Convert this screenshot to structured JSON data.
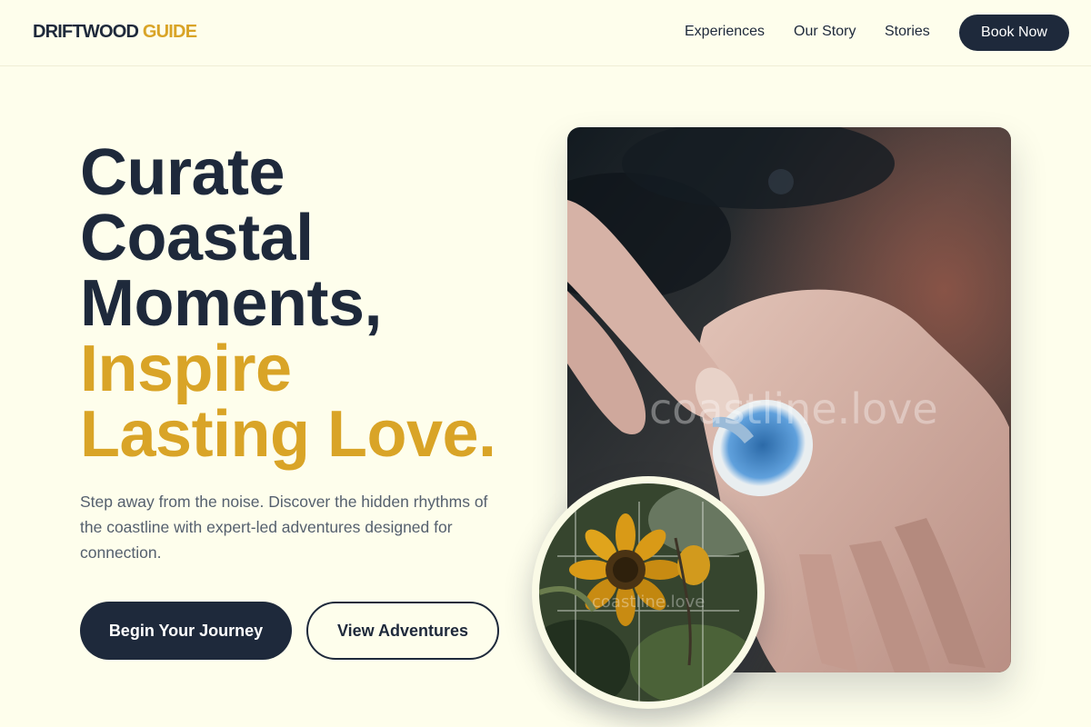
{
  "header": {
    "brand_primary": "DRIFTWOOD",
    "brand_accent": "GUIDE",
    "nav": [
      "Experiences",
      "Our Story",
      "Stories"
    ],
    "cta": "Book Now"
  },
  "hero": {
    "title_lines": [
      "Curate",
      "Coastal",
      "Moments,"
    ],
    "title_accent_lines": [
      "Inspire",
      "Lasting Love."
    ],
    "subtitle": "Step away from the noise. Discover the hidden rhythms of the coastline with expert-led adventures designed for connection.",
    "primary_button": "Begin Your Journey",
    "secondary_button": "View Adventures"
  },
  "images": {
    "main_watermark": "coastline.love",
    "circle_watermark": "coastline.love"
  },
  "colors": {
    "background": "#fefeec",
    "navy": "#1e293b",
    "gold": "#d9a427"
  }
}
